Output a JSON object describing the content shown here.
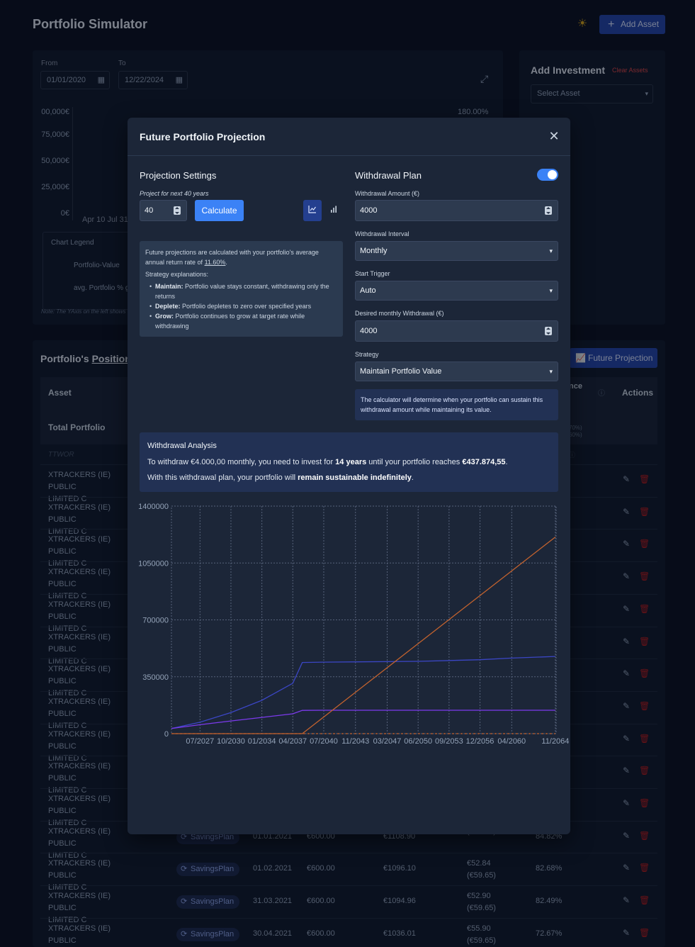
{
  "app": {
    "title": "Portfolio Simulator",
    "add_asset_label": "Add Asset"
  },
  "chart_card": {
    "from_label": "From",
    "to_label": "To",
    "from_value": "01/01/2020",
    "to_value": "12/22/2024",
    "y_ticks": [
      "00,000€",
      "75,000€",
      "50,000€",
      "25,000€",
      "0€"
    ],
    "right_tick": "180.00%",
    "x_tick_partial": "Apr 10 Jul 31",
    "legend_title": "Chart Legend",
    "legend_items": [
      "Portfolio-Value",
      "avg. Portfolio % g"
    ],
    "note": "Note: The YAxis on the left shows the"
  },
  "invest_card": {
    "title": "Add Investment",
    "clear_label": "Clear Assets",
    "select_placeholder": "Select Asset"
  },
  "positions": {
    "title_prefix": "Portfolio's ",
    "title_link": "Position",
    "future_btn": "Future Projection",
    "col_asset": "Asset",
    "col_total": "Total Portfolio",
    "col_performance_partial": "nce",
    "col_actions": "Actions",
    "total_pct": [
      "70%)",
      "60%)"
    ],
    "ttwor": "TTWOR",
    "asset_name_line1": "XTRACKERS (IE) PUBLIC",
    "asset_name_line2": "LIMITED C",
    "visible_rows": [
      {
        "badge": "SavingsPlan",
        "date": "01.01.2021",
        "amount": "€600.00",
        "price": "€1108.90",
        "dividend": "",
        "dividend2": "(€59.65)",
        "perf": "84.82%"
      },
      {
        "badge": "SavingsPlan",
        "date": "01.02.2021",
        "amount": "€600.00",
        "price": "€1096.10",
        "dividend": "€52.84",
        "dividend2": "(€59.65)",
        "perf": "82.68%"
      },
      {
        "badge": "SavingsPlan",
        "date": "31.03.2021",
        "amount": "€600.00",
        "price": "€1094.96",
        "dividend": "€52.90",
        "dividend2": "(€59.65)",
        "perf": "82.49%"
      },
      {
        "badge": "SavingsPlan",
        "date": "30.04.2021",
        "amount": "€600.00",
        "price": "€1036.01",
        "dividend": "€55.90",
        "dividend2": "(€59.65)",
        "perf": "72.67%"
      }
    ]
  },
  "modal": {
    "title": "Future Portfolio Projection",
    "settings_title": "Projection Settings",
    "project_label": "Project for next 40 years",
    "years_value": "40",
    "calculate_label": "Calculate",
    "info_line1": "Future projections are calculated with your portfolio's average annual return rate of ",
    "info_rate": "11.60%",
    "info_period": ".",
    "strategy_heading": "Strategy explanations:",
    "strategies": [
      {
        "name": "Maintain:",
        "desc": " Portfolio value stays constant, withdrawing only the returns"
      },
      {
        "name": "Deplete:",
        "desc": " Portfolio depletes to zero over specified years"
      },
      {
        "name": "Grow:",
        "desc": " Portfolio continues to grow at target rate while withdrawing"
      }
    ],
    "withdrawal_title": "Withdrawal Plan",
    "withdrawal_amount_label": "Withdrawal Amount (€)",
    "withdrawal_amount": "4000",
    "interval_label": "Withdrawal Interval",
    "interval_value": "Monthly",
    "trigger_label": "Start Trigger",
    "trigger_value": "Auto",
    "desired_label": "Desired monthly Withdrawal (€)",
    "desired_value": "4000",
    "strategy_label": "Strategy",
    "strategy_value": "Maintain Portfolio Value",
    "note": "The calculator will determine when your portfolio can sustain this withdrawal amount while maintaining its value.",
    "analysis": {
      "title": "Withdrawal Analysis",
      "l1_a": "To withdraw €4.000,00 monthly, you need to invest for ",
      "l1_b": "14 years",
      "l1_c": " until your portfolio reaches ",
      "l1_d": "€437.874,55",
      "l1_e": ".",
      "l2_a": "With this withdrawal plan, your portfolio will ",
      "l2_b": "remain sustainable indefinitely",
      "l2_c": "."
    }
  },
  "chart_data": {
    "type": "line",
    "title": "",
    "xlabel": "",
    "ylabel": "",
    "x_range": [
      "07/2024",
      "12/2064"
    ],
    "x_ticks": [
      "07/2027",
      "10/2030",
      "01/2034",
      "04/2037",
      "07/2040",
      "11/2043",
      "03/2047",
      "06/2050",
      "09/2053",
      "12/2056",
      "04/2060",
      "11/2064"
    ],
    "y_ticks": [
      0,
      350000,
      700000,
      1050000,
      1400000
    ],
    "ylim": [
      0,
      1400000
    ],
    "grid": true,
    "series": [
      {
        "color": "#3b46c4",
        "x": [
          "07/2024",
          "07/2027",
          "10/2030",
          "01/2034",
          "04/2037",
          "04/2038",
          "07/2040",
          "06/2050",
          "12/2056",
          "04/2060",
          "11/2064"
        ],
        "y": [
          32000,
          70000,
          130000,
          205000,
          310000,
          437900,
          440000,
          445000,
          455000,
          465000,
          475000
        ]
      },
      {
        "color": "#7c3aed",
        "x": [
          "07/2024",
          "07/2027",
          "10/2030",
          "01/2034",
          "04/2037",
          "04/2038",
          "07/2040",
          "11/2064"
        ],
        "y": [
          32000,
          55000,
          78000,
          100000,
          122000,
          143000,
          144000,
          144000
        ]
      },
      {
        "color": "#c2622e",
        "x": [
          "07/2024",
          "04/2038",
          "11/2064"
        ],
        "y": [
          0,
          0,
          1210000
        ]
      },
      {
        "color": "#c2622e",
        "dashed": true,
        "x": [
          "07/2024",
          "11/2064"
        ],
        "y": [
          0,
          0
        ]
      }
    ]
  }
}
